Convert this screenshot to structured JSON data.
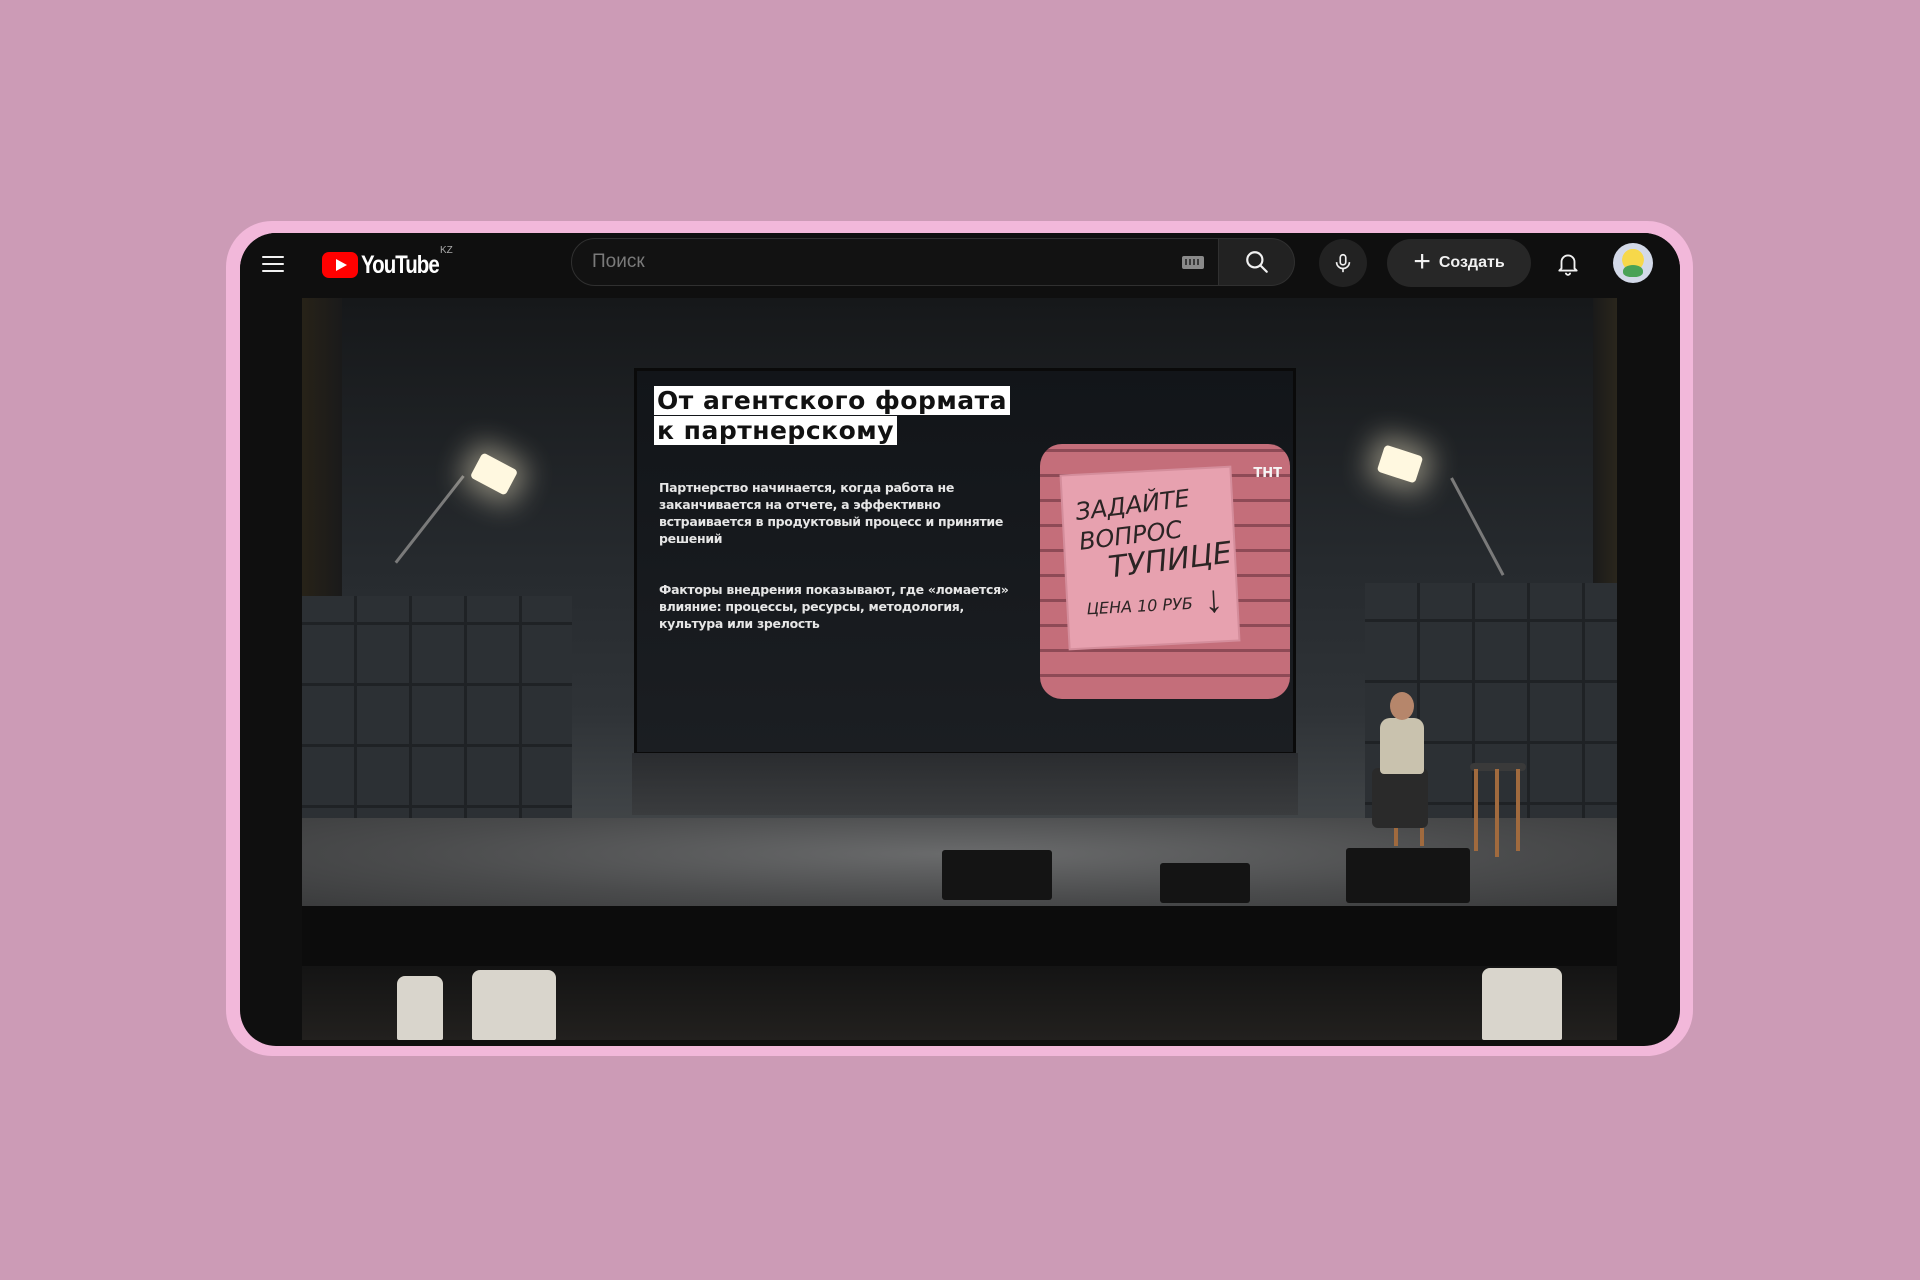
{
  "app": {
    "logo_text": "YouTube",
    "region_badge": "KZ"
  },
  "header": {
    "menu_icon": "hamburger-menu-icon",
    "search": {
      "placeholder": "Поиск",
      "value": ""
    },
    "create_label": "Создать",
    "icons": [
      "keyboard-icon",
      "search-icon",
      "mic-icon",
      "plus-icon",
      "bell-icon",
      "avatar"
    ]
  },
  "video": {
    "slide": {
      "title_line1": "От агентского формата",
      "title_line2": "к партнерскому",
      "paragraph1": "Партнерство начинается, когда работа не заканчивается на отчете, а эффективно встраивается в продуктовый процесс и принятие решений",
      "paragraph2": "Факторы внедрения показывают, где «ломается» влияние: процессы, ресурсы, методология, культура или зрелость",
      "image": {
        "sign_line1": "ЗАДАЙТЕ",
        "sign_line2": "ВОПРОС",
        "sign_line3": "ТУПИЦЕ",
        "sign_price": "ЦЕНА 10 РУБ",
        "channel_logo": "ТНТ"
      }
    }
  },
  "colors": {
    "page_background": "#cc9bb6",
    "frame": "#f2b8da",
    "topbar": "#0f0f0f",
    "youtube_red": "#ff0000"
  }
}
